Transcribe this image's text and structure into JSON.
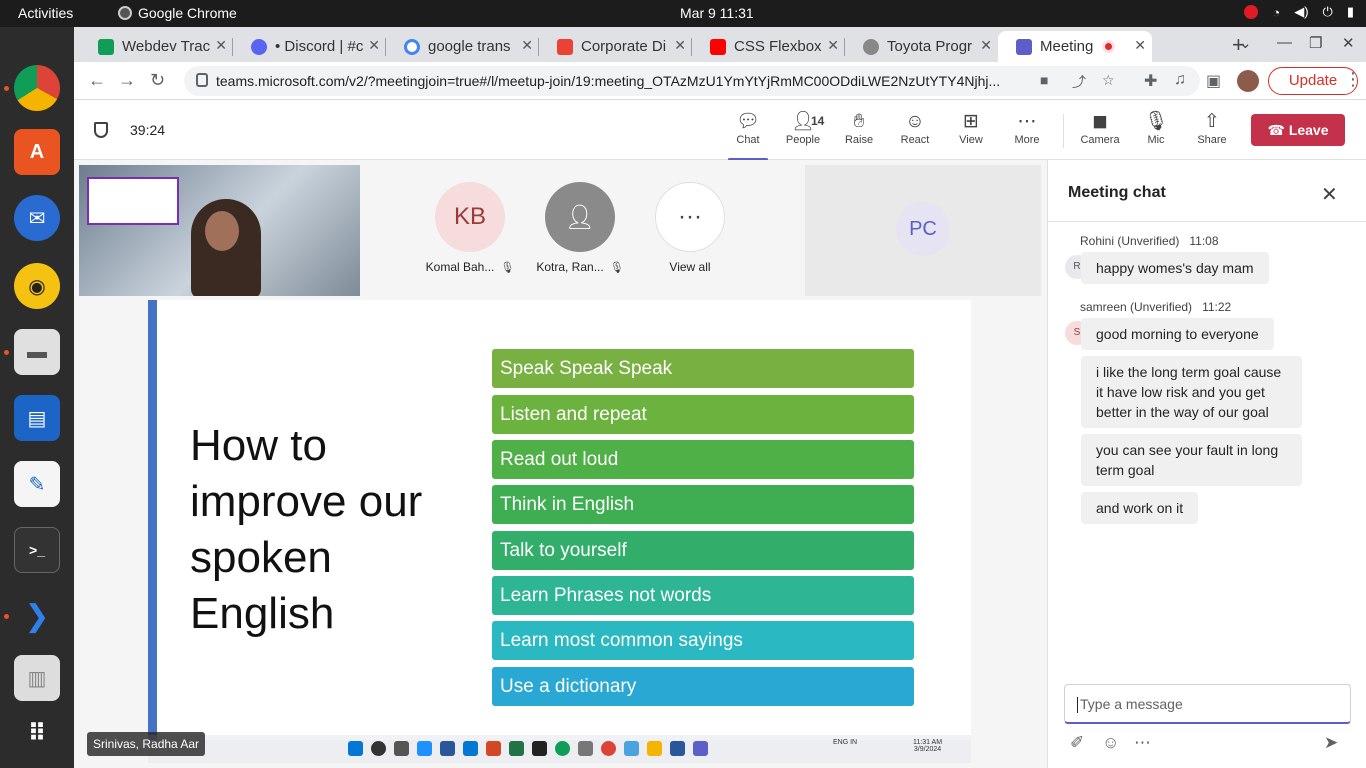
{
  "system": {
    "activities": "Activities",
    "app_name": "Google Chrome",
    "clock": "Mar 9  11:31"
  },
  "browser": {
    "tabs": [
      {
        "label": "Webdev Trac",
        "color": "#0f9d58"
      },
      {
        "label": "• Discord | #c",
        "color": "#5865f2"
      },
      {
        "label": "google trans",
        "color": "#4285f4"
      },
      {
        "label": "Corporate Di",
        "color": "#ea4335"
      },
      {
        "label": "CSS Flexbox",
        "color": "#ff0000"
      },
      {
        "label": "Toyota Progr",
        "color": "#888888"
      },
      {
        "label": "Meeting",
        "color": "#5b5fc7"
      }
    ],
    "url": "teams.microsoft.com/v2/?meetingjoin=true#/l/meetup-join/19:meeting_OTAzMzU1YmYtYjRmMC00ODdiLWE2NzUtYTY4Njhj...",
    "update_label": "Update"
  },
  "teams": {
    "timer": "39:24",
    "toolbar": {
      "chat": "Chat",
      "people": "People",
      "people_count": "14",
      "raise": "Raise",
      "react": "React",
      "view": "View",
      "more": "More",
      "camera": "Camera",
      "mic": "Mic",
      "share": "Share",
      "leave": "Leave"
    },
    "participants": [
      {
        "initials": "KB",
        "name": "Komal Bah..."
      },
      {
        "initials": "",
        "name": "Kotra, Ran..."
      },
      {
        "initials": "···",
        "name": "View all"
      }
    ],
    "pc_initials": "PC",
    "presenter_chip": "Srinivas, Radha Aar"
  },
  "slide": {
    "title": "How to improve our spoken English",
    "tips": [
      "Speak Speak Speak",
      "Listen and repeat",
      "Read out loud",
      "Think in English",
      "Talk to yourself",
      "Learn Phrases not words",
      "Learn most common sayings",
      "Use a dictionary"
    ],
    "tip_colors": [
      "#78b042",
      "#6cb23e",
      "#4eb046",
      "#3fae52",
      "#33ae6a",
      "#2db594",
      "#2ab8c2",
      "#28a8d2"
    ],
    "taskbar_lang": "ENG IN",
    "taskbar_time": "11:31 AM",
    "taskbar_date": "3/9/2024"
  },
  "chat": {
    "header": "Meeting chat",
    "messages": [
      {
        "sender": "Rohini (Unverified)",
        "time": "11:08",
        "initial": "R",
        "texts": [
          "happy womes's day mam"
        ]
      },
      {
        "sender": "samreen (Unverified)",
        "time": "11:22",
        "initial": "S",
        "texts": [
          "good morning to everyone",
          "i like the long term goal cause it have low risk and you get better in the way of our goal",
          "you can see your fault in long term goal",
          "and work on it"
        ]
      }
    ],
    "placeholder": "Type a message"
  }
}
